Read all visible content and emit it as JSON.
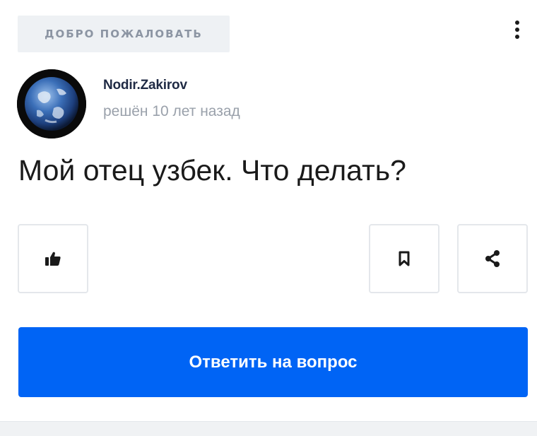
{
  "header": {
    "tag_label": "ДОБРО ПОЖАЛОВАТЬ",
    "menu_icon": "kebab-menu-icon"
  },
  "author": {
    "username": "Nodir.Zakirov",
    "meta": "решён 10 лет назад",
    "avatar_icon": "earth-avatar"
  },
  "question": {
    "text": "Мой отец узбек. Что делать?"
  },
  "actions": {
    "like_icon": "thumbs-up-icon",
    "bookmark_icon": "bookmark-icon",
    "share_icon": "share-icon"
  },
  "answer_button": {
    "label": "Ответить на вопрос"
  },
  "colors": {
    "accent": "#0064f5",
    "tag_bg": "#eef1f4",
    "tag_text": "#8c95a3",
    "meta_text": "#9aa1ab",
    "username_text": "#1f2a44"
  }
}
